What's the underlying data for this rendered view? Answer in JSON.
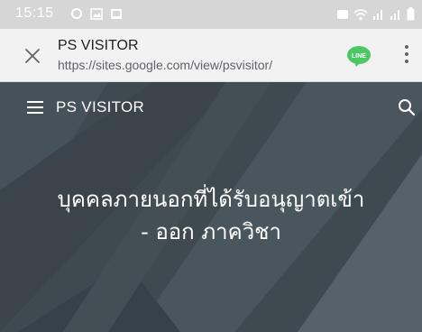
{
  "status_bar": {
    "time": "15:15",
    "left_icons": [
      "settings-icon",
      "image-icon",
      "image-icon"
    ],
    "right_icons": [
      "alarm-icon",
      "wifi-icon",
      "signal-icon",
      "signal-icon",
      "battery-icon"
    ]
  },
  "browser": {
    "title": "PS VISITOR",
    "url": "https://sites.google.com/view/psvisitor/",
    "line_label": "LINE",
    "line_color": "#4cc764"
  },
  "site": {
    "nav_title": "PS VISITOR",
    "hero_lines": [
      "บุคคลภายนอกที่ได้รับอนุญาตเข้า",
      "- ออก ภาควิชา"
    ],
    "background_color": "#3f4a50"
  }
}
